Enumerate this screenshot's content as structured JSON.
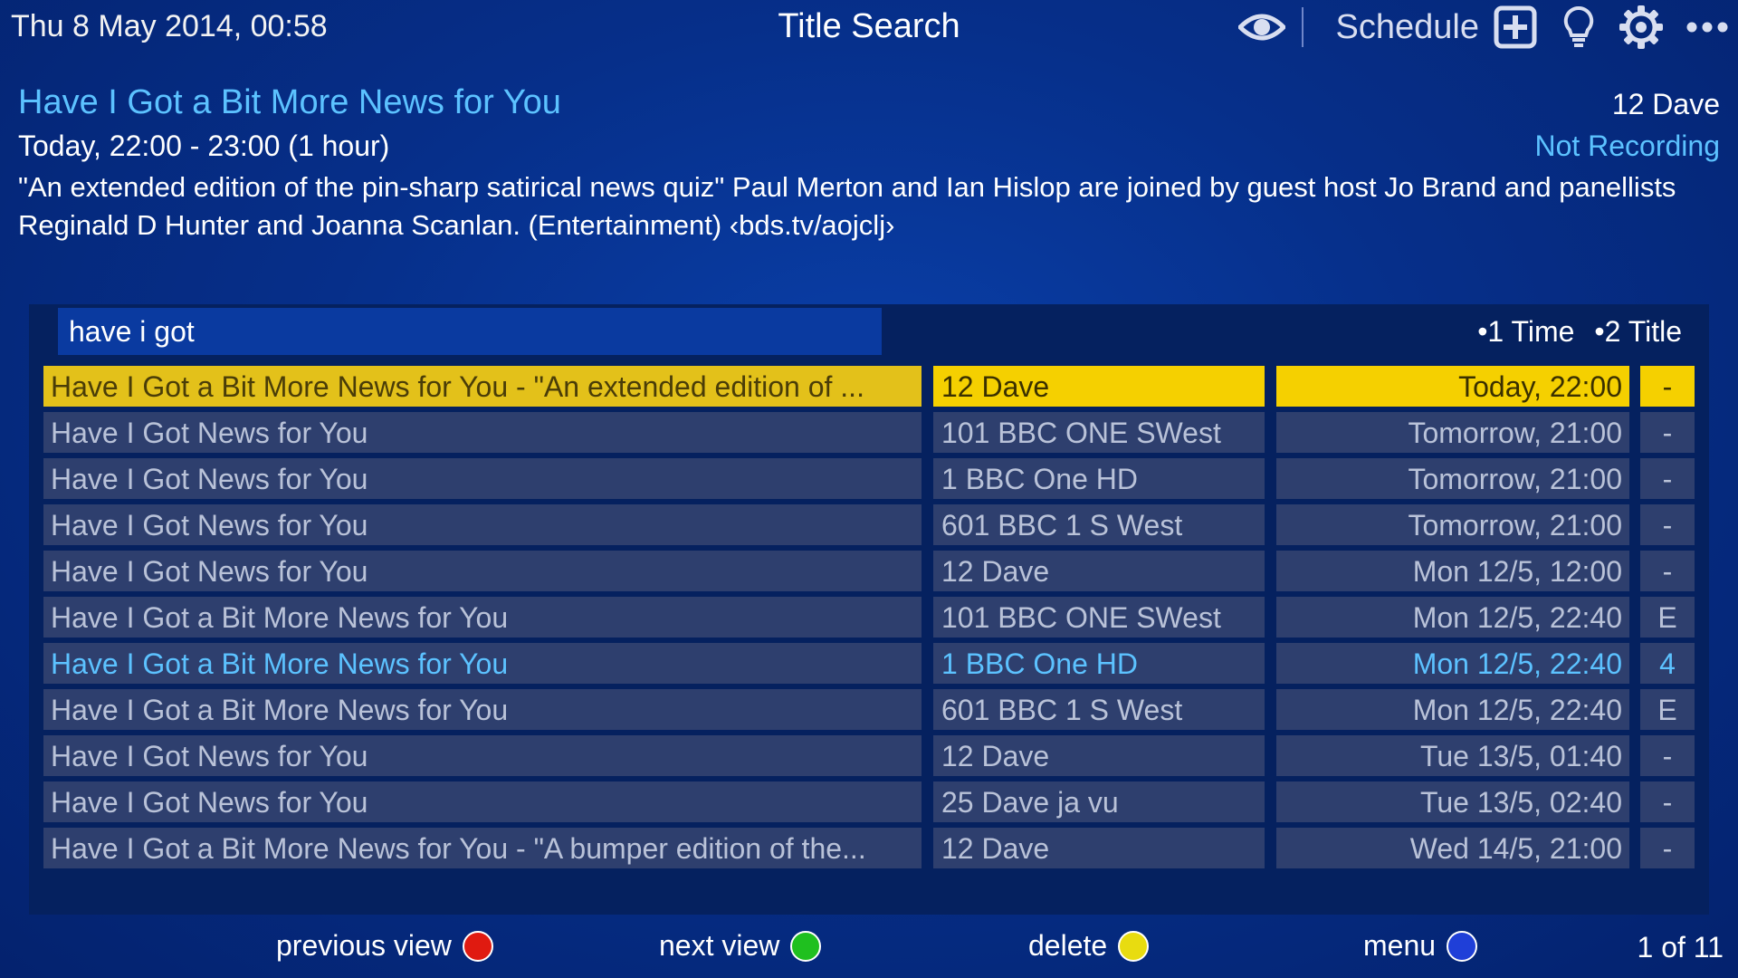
{
  "header": {
    "datetime": "Thu 8 May 2014, 00:58",
    "title": "Title Search",
    "schedule_label": "Schedule"
  },
  "programme": {
    "title": "Have I Got a Bit More News for You",
    "time": "Today, 22:00 - 23:00 (1 hour)",
    "channel": "12 Dave",
    "recording_status": "Not Recording",
    "description": "\"An extended edition of the pin-sharp satirical news quiz\" Paul Merton and Ian Hislop are joined by guest host Jo Brand and panellists Reginald D Hunter and Joanna Scanlan. (Entertainment) ‹bds.tv/aojclj›"
  },
  "search": {
    "query": "have i got",
    "sort_options": [
      "•1 Time",
      "•2 Title"
    ]
  },
  "results": [
    {
      "title": "Have I Got a Bit More News for You - \"An extended edition of ...",
      "channel": "12 Dave",
      "time": "Today, 22:00",
      "flag": "-"
    },
    {
      "title": "Have I Got News for You",
      "channel": "101 BBC ONE SWest",
      "time": "Tomorrow, 21:00",
      "flag": "-"
    },
    {
      "title": "Have I Got News for You",
      "channel": "1 BBC One HD",
      "time": "Tomorrow, 21:00",
      "flag": "-"
    },
    {
      "title": "Have I Got News for You",
      "channel": "601 BBC 1 S West",
      "time": "Tomorrow, 21:00",
      "flag": "-"
    },
    {
      "title": "Have I Got News for You",
      "channel": "12 Dave",
      "time": "Mon 12/5, 12:00",
      "flag": "-"
    },
    {
      "title": "Have I Got a Bit More News for You",
      "channel": "101 BBC ONE SWest",
      "time": "Mon 12/5, 22:40",
      "flag": "E"
    },
    {
      "title": "Have I Got a Bit More News for You",
      "channel": "1 BBC One HD",
      "time": "Mon 12/5, 22:40",
      "flag": "4"
    },
    {
      "title": "Have I Got a Bit More News for You",
      "channel": "601 BBC 1 S West",
      "time": "Mon 12/5, 22:40",
      "flag": "E"
    },
    {
      "title": "Have I Got News for You",
      "channel": "12 Dave",
      "time": "Tue 13/5, 01:40",
      "flag": "-"
    },
    {
      "title": "Have I Got News for You",
      "channel": "25 Dave ja vu",
      "time": "Tue 13/5, 02:40",
      "flag": "-"
    },
    {
      "title": "Have I Got a Bit More News for You - \"A bumper edition of the...",
      "channel": "12 Dave",
      "time": "Wed 14/5, 21:00",
      "flag": "-"
    }
  ],
  "footer": {
    "buttons": [
      {
        "label": "previous view",
        "color": "#e01a10"
      },
      {
        "label": "next view",
        "color": "#1fc01f"
      },
      {
        "label": "delete",
        "color": "#e8dc10"
      },
      {
        "label": "menu",
        "color": "#1f3fd8"
      }
    ],
    "page_info": "1 of 11"
  },
  "colors": {
    "accent": "#5cc2ff",
    "selection": "#f5d000",
    "row": "#2e3f6e"
  },
  "icons": [
    "eye-icon",
    "plus-box-icon",
    "lightbulb-icon",
    "gear-icon",
    "more-dots-icon"
  ]
}
